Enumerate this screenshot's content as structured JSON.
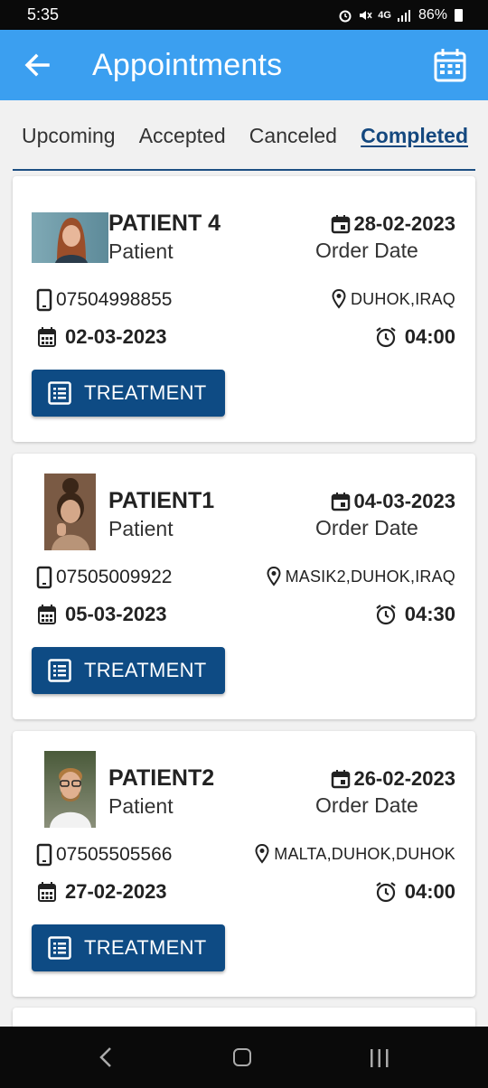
{
  "status": {
    "time": "5:35",
    "network": "4G",
    "battery": "86%"
  },
  "app_bar": {
    "title": "Appointments"
  },
  "tabs": [
    {
      "label": "Upcoming",
      "active": false
    },
    {
      "label": "Accepted",
      "active": false
    },
    {
      "label": "Canceled",
      "active": false
    },
    {
      "label": "Completed",
      "active": true
    }
  ],
  "colors": {
    "app_bar": "#3b9ff0",
    "accent": "#0e4b84",
    "active_tab": "#14487f"
  },
  "appointments": [
    {
      "name": "PATIENT 4",
      "role": "Patient",
      "order_date": "28-02-2023",
      "order_label": "Order Date",
      "phone": "07504998855",
      "location": "DUHOK,IRAQ",
      "date": "02-03-2023",
      "time": "04:00",
      "button": "TREATMENT"
    },
    {
      "name": "PATIENT1",
      "role": "Patient",
      "order_date": "04-03-2023",
      "order_label": "Order Date",
      "phone": "07505009922",
      "location": "MASIK2,DUHOK,IRAQ",
      "date": "05-03-2023",
      "time": "04:30",
      "button": "TREATMENT"
    },
    {
      "name": "PATIENT2",
      "role": "Patient",
      "order_date": "26-02-2023",
      "order_label": "Order Date",
      "phone": "07505505566",
      "location": "MALTA,DUHOK,DUHOK",
      "date": "27-02-2023",
      "time": "04:00",
      "button": "TREATMENT"
    }
  ]
}
